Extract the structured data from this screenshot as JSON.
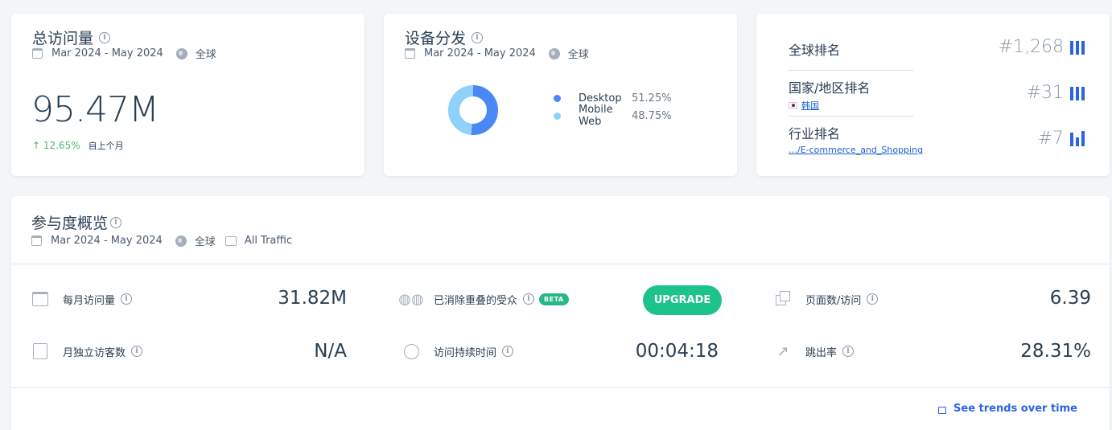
{
  "total_visits": {
    "title": "总访问量",
    "date_range": "Mar 2024 - May 2024",
    "region": "全球",
    "value": "95.47M",
    "change": "↑ 12.65%",
    "change_label": "自上个月"
  },
  "device": {
    "title": "设备分发",
    "date_range": "Mar 2024 - May 2024",
    "region": "全球",
    "items": [
      {
        "name": "Desktop",
        "pct": "51.25%",
        "value": 51.25,
        "color": "#4a88f5"
      },
      {
        "name": "Mobile Web",
        "pct": "48.75%",
        "value": 48.75,
        "color": "#8fd1fb"
      }
    ]
  },
  "ranking": {
    "global_label": "全球排名",
    "global_value": "#1,268",
    "country_label": "国家/地区排名",
    "country_name": "韩国",
    "country_value": "#31",
    "industry_label": "行业排名",
    "industry_name": "…/E-commerce_and_Shopping",
    "industry_value": "#7",
    "accent": "#2b64e3"
  },
  "engagement": {
    "title": "参与度概览",
    "date_range": "Mar 2024 - May 2024",
    "region": "全球",
    "traffic": "All Traffic",
    "monthly_visits_label": "每月访问量",
    "monthly_visits_value": "31.82M",
    "unique_visitors_label": "月独立访客数",
    "unique_visitors_value": "N/A",
    "dedup_label": "已消除重叠的受众",
    "beta": "BETA",
    "upgrade": "UPGRADE",
    "duration_label": "访问持续时间",
    "duration_value": "00:04:18",
    "pages_label": "页面数/访问",
    "pages_value": "6.39",
    "bounce_label": "跳出率",
    "bounce_value": "28.31%",
    "trends": "See trends over time"
  }
}
